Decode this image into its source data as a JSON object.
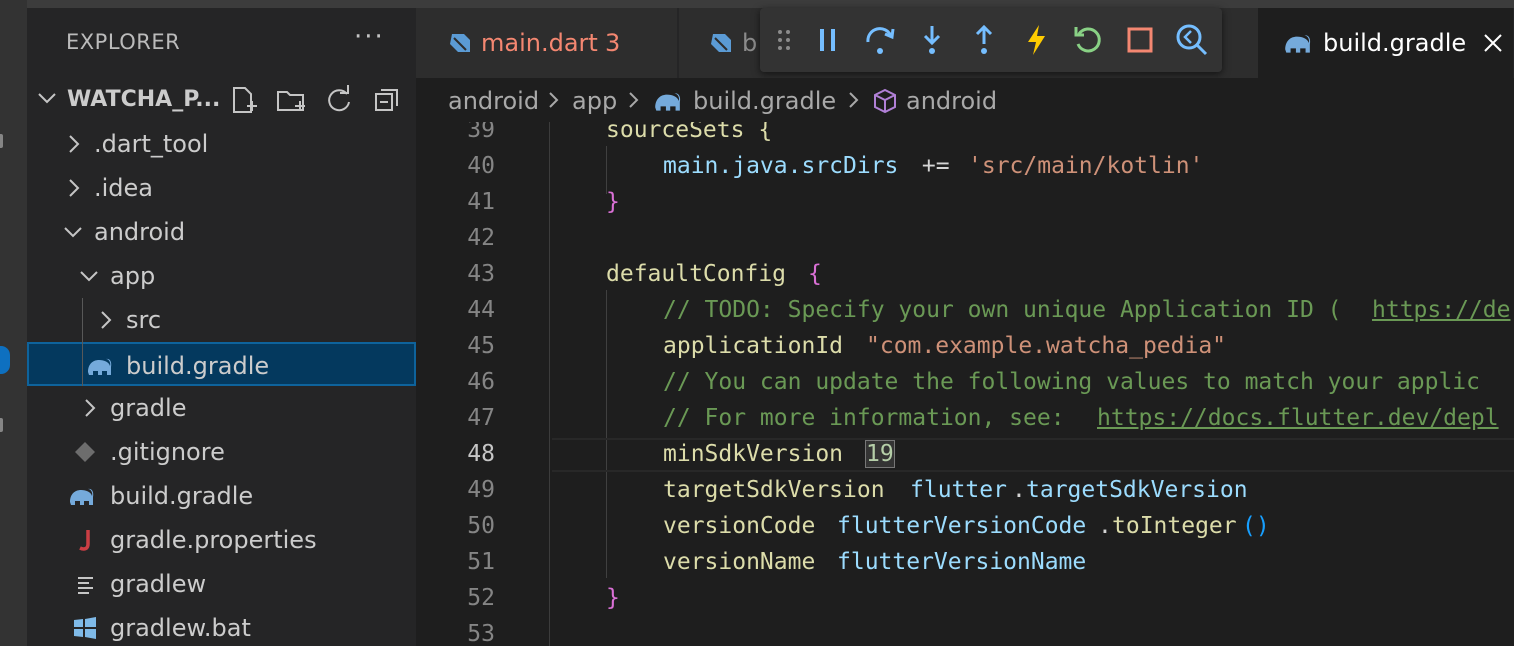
{
  "sidebar": {
    "title": "EXPLORER",
    "more": "···",
    "project": "WATCHA_P...",
    "tree": [
      {
        "label": ".dart_tool"
      },
      {
        "label": ".idea"
      },
      {
        "label": "android"
      },
      {
        "label": "app"
      },
      {
        "label": "src"
      },
      {
        "label": "build.gradle"
      },
      {
        "label": "gradle"
      },
      {
        "label": ".gitignore"
      },
      {
        "label": "build.gradle"
      },
      {
        "label": "gradle.properties"
      },
      {
        "label": "gradlew"
      },
      {
        "label": "gradlew.bat"
      }
    ]
  },
  "tabs": {
    "main_dart": "main.dart",
    "main_dart_problems": "3",
    "partial": "b",
    "build_gradle": "build.gradle"
  },
  "breadcrumb": {
    "p1": "android",
    "p2": "app",
    "p3": "build.gradle",
    "p4": "android"
  },
  "code": {
    "lines": [
      {
        "n": "39"
      },
      {
        "n": "40"
      },
      {
        "n": "41"
      },
      {
        "n": "42"
      },
      {
        "n": "43"
      },
      {
        "n": "44"
      },
      {
        "n": "45"
      },
      {
        "n": "46"
      },
      {
        "n": "47"
      },
      {
        "n": "48"
      },
      {
        "n": "49"
      },
      {
        "n": "50"
      },
      {
        "n": "51"
      },
      {
        "n": "52"
      },
      {
        "n": "53"
      }
    ],
    "l39": "sourceSets {",
    "l40a": "main.java.srcDirs",
    "l40b": " += ",
    "l40c": "'src/main/kotlin'",
    "l41": "}",
    "l43a": "defaultConfig",
    "l43b": "{",
    "l44a": "// TODO: Specify your own unique Application ID (",
    "l44b": "https://de",
    "l45a": "applicationId",
    "l45b": "\"com.example.watcha_pedia\"",
    "l46": "// You can update the following values to match your applic",
    "l47a": "// For more information, see: ",
    "l47b": "https://docs.flutter.dev/depl",
    "l48a": "minSdkVersion",
    "l48b": "19",
    "l49a": "targetSdkVersion",
    "l49b": "flutter",
    "l49c": ".",
    "l49d": "targetSdkVersion",
    "l50a": "versionCode",
    "l50b": "flutterVersionCode",
    "l50c": ".",
    "l50d": "toInteger",
    "l50e": "()",
    "l51a": "versionName",
    "l51b": "flutterVersionName",
    "l52": "}"
  },
  "colors": {
    "tab_warning": "#f48771",
    "gradle_icon": "#75aadb",
    "debug_continue": "#75beff",
    "debug_hot_reload": "#ffcc00",
    "debug_restart": "#89d185",
    "debug_stop": "#f48771"
  }
}
